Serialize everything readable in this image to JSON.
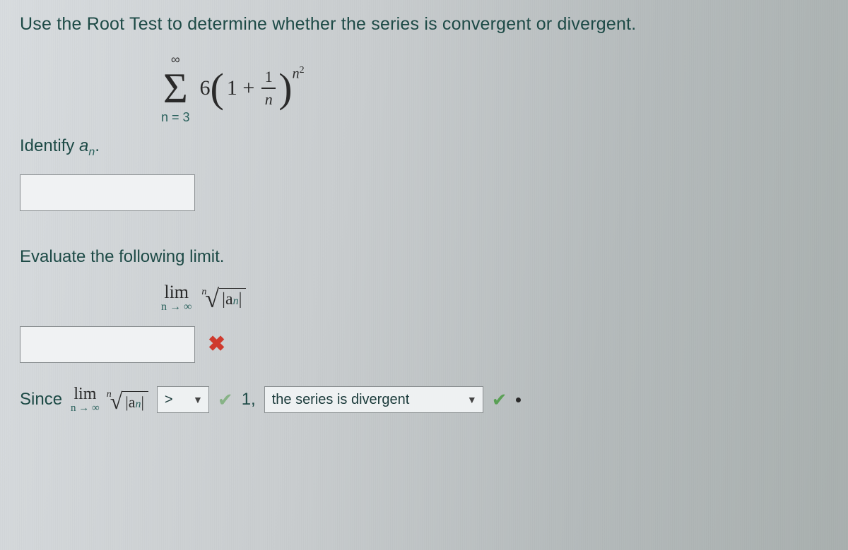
{
  "prompt": "Use the Root Test to determine whether the series is convergent or divergent.",
  "series": {
    "sigma_top": "∞",
    "sigma_bottom": "n = 3",
    "coeff": "6",
    "inside_left": "1 +",
    "frac_num": "1",
    "frac_den": "n",
    "exponent_base": "n",
    "exponent_sup": "2"
  },
  "identify": {
    "label_pre": "Identify ",
    "a": "a",
    "sub": "n",
    "label_post": "."
  },
  "evaluate_label": "Evaluate the following limit.",
  "limit": {
    "lim_word": "lim",
    "lim_cond": "n → ∞",
    "root_index": "n",
    "rad_open": "|a",
    "rad_sub": "n",
    "rad_close": "|"
  },
  "conclusion": {
    "since": "Since",
    "lim_word": "lim",
    "lim_cond": "n → ∞",
    "root_index": "n",
    "rad_open": "|a",
    "rad_sub": "n",
    "rad_close": "|",
    "compare_selected": ">",
    "one_comma": "1,",
    "verdict_selected": "the series is divergent"
  }
}
